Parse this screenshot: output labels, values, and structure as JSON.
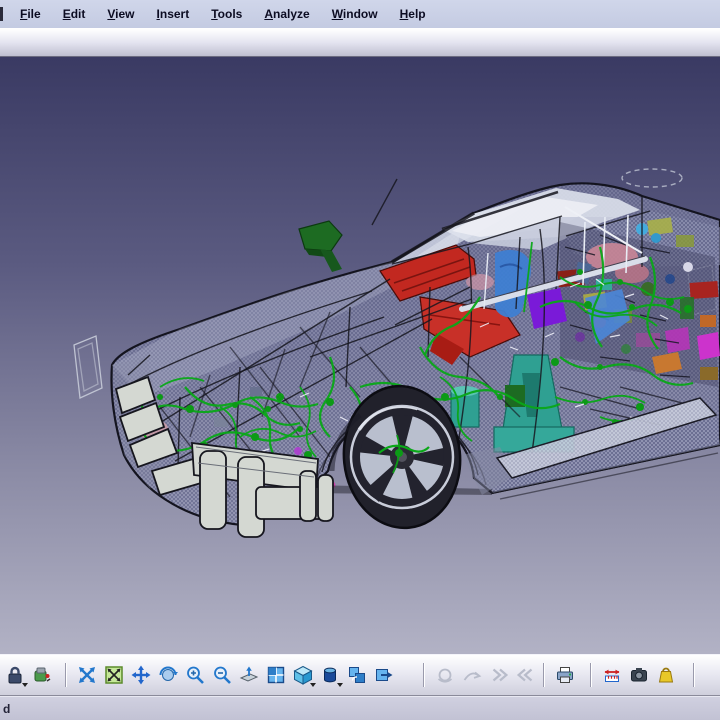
{
  "menu_bar": {
    "items": [
      {
        "label": "File"
      },
      {
        "label": "Edit"
      },
      {
        "label": "View"
      },
      {
        "label": "Insert"
      },
      {
        "label": "Tools"
      },
      {
        "label": "Analyze"
      },
      {
        "label": "Window"
      },
      {
        "label": "Help"
      }
    ]
  },
  "viewport": {
    "description": "3D CAD view of a transparent sports car showing internal wiring harness and components",
    "colors": {
      "background_top": "#3b3b65",
      "background_bottom": "#b2b2c5",
      "harness_green": "#0aa818",
      "engine_red": "#c22820",
      "seat_blue": "#3e7ed2",
      "component_purple": "#7a1ad8",
      "component_teal": "#2fa092",
      "component_magenta": "#cc33cc",
      "body_gray": "#b2b6cc"
    }
  },
  "bottom_toolbar": {
    "groups": [
      {
        "icons": [
          {
            "name": "lock-icon",
            "dropdown": true
          },
          {
            "name": "workbench-icon",
            "dropdown": false
          }
        ]
      },
      {
        "icons": [
          {
            "name": "fly-mode-icon",
            "dropdown": false
          },
          {
            "name": "fit-all-icon",
            "dropdown": false
          },
          {
            "name": "pan-icon",
            "dropdown": false
          },
          {
            "name": "rotate-icon",
            "dropdown": false
          },
          {
            "name": "zoom-in-icon",
            "dropdown": false
          },
          {
            "name": "zoom-out-icon",
            "dropdown": false
          },
          {
            "name": "normal-view-icon",
            "dropdown": false
          },
          {
            "name": "quick-view-icon",
            "dropdown": false
          },
          {
            "name": "iso-view-icon",
            "dropdown": true
          },
          {
            "name": "render-style-icon",
            "dropdown": true
          },
          {
            "name": "hide-show-icon",
            "dropdown": false
          },
          {
            "name": "swap-space-icon",
            "dropdown": false
          }
        ]
      },
      {
        "icons": [
          {
            "name": "turn-head-icon-disabled",
            "dropdown": false
          },
          {
            "name": "fly-path-icon-disabled",
            "dropdown": false
          },
          {
            "name": "accelerate-icon-disabled",
            "dropdown": false
          },
          {
            "name": "decelerate-icon-disabled",
            "dropdown": false
          }
        ]
      },
      {
        "icons": [
          {
            "name": "print-icon",
            "dropdown": false
          }
        ]
      },
      {
        "icons": [
          {
            "name": "measure-icon",
            "dropdown": false
          },
          {
            "name": "capture-icon",
            "dropdown": false
          },
          {
            "name": "inertia-icon",
            "dropdown": false
          }
        ]
      }
    ]
  },
  "status_bar": {
    "text": "d"
  }
}
